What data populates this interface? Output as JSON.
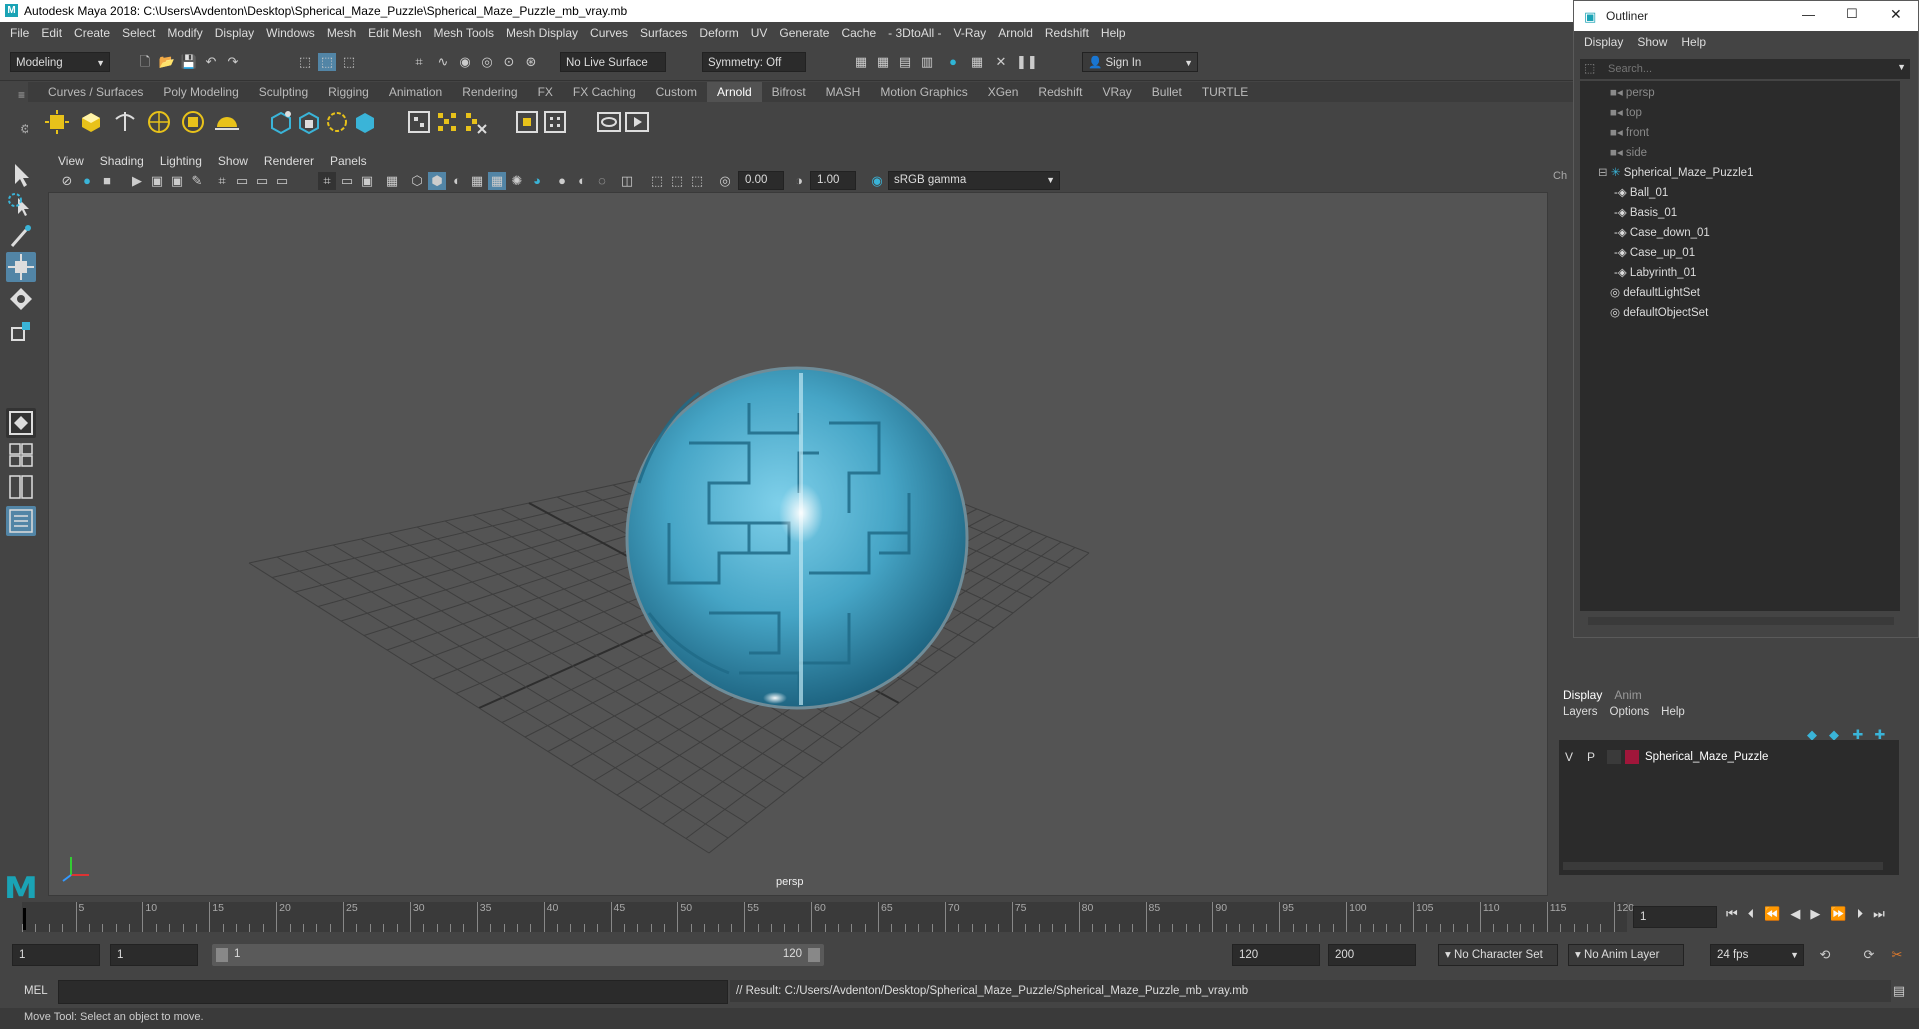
{
  "window": {
    "title": "Autodesk Maya 2018: C:\\Users\\Avdenton\\Desktop\\Spherical_Maze_Puzzle\\Spherical_Maze_Puzzle_mb_vray.mb",
    "logo_letter": "M"
  },
  "menubar": [
    "File",
    "Edit",
    "Create",
    "Select",
    "Modify",
    "Display",
    "Windows",
    "Mesh",
    "Edit Mesh",
    "Mesh Tools",
    "Mesh Display",
    "Curves",
    "Surfaces",
    "Deform",
    "UV",
    "Generate",
    "Cache",
    "- 3DtoAll -",
    "V-Ray",
    "Arnold",
    "Redshift",
    "Help"
  ],
  "statusline": {
    "mode": "Modeling",
    "live_surface": "No Live Surface",
    "symmetry": "Symmetry: Off",
    "sign_in": "Sign In"
  },
  "shelf": {
    "tabs": [
      "Curves / Surfaces",
      "Poly Modeling",
      "Sculpting",
      "Rigging",
      "Animation",
      "Rendering",
      "FX",
      "FX Caching",
      "Custom",
      "Arnold",
      "Bifrost",
      "MASH",
      "Motion Graphics",
      "XGen",
      "Redshift",
      "VRay",
      "Bullet",
      "TURTLE"
    ],
    "active_tab": "Arnold"
  },
  "viewport": {
    "menu": [
      "View",
      "Shading",
      "Lighting",
      "Show",
      "Renderer",
      "Panels"
    ],
    "exposure": "0.00",
    "gamma": "1.00",
    "color_space": "sRGB gamma",
    "camera_label": "persp"
  },
  "outliner": {
    "title": "Outliner",
    "menu": [
      "Display",
      "Show",
      "Help"
    ],
    "search_placeholder": "Search...",
    "cameras": [
      "persp",
      "top",
      "front",
      "side"
    ],
    "group": "Spherical_Maze_Puzzle1",
    "children": [
      "Ball_01",
      "Basis_01",
      "Case_down_01",
      "Case_up_01",
      "Labyrinth_01"
    ],
    "sets": [
      "defaultLightSet",
      "defaultObjectSet"
    ],
    "channel_tab_cut": "Ch"
  },
  "layers": {
    "tabs": [
      "Display",
      "Anim"
    ],
    "active_tab": "Display",
    "menu": [
      "Layers",
      "Options",
      "Help"
    ],
    "rows": [
      {
        "v": "V",
        "p": "P",
        "name": "Spherical_Maze_Puzzle",
        "color": "#a0163a"
      }
    ]
  },
  "timeline": {
    "ticks": [
      "5",
      "10",
      "15",
      "20",
      "25",
      "30",
      "35",
      "40",
      "45",
      "50",
      "55",
      "60",
      "65",
      "70",
      "75",
      "80",
      "85",
      "90",
      "95",
      "100",
      "105",
      "110",
      "115",
      "120"
    ],
    "current_frame": "1"
  },
  "range": {
    "start": "1",
    "start2": "1",
    "slider_start": "1",
    "slider_end": "120",
    "end": "120",
    "end2": "200",
    "character_set": "No Character Set",
    "anim_layer": "No Anim Layer",
    "fps": "24 fps"
  },
  "command": {
    "lang": "MEL",
    "result": "// Result: C:/Users/Avdenton/Desktop/Spherical_Maze_Puzzle/Spherical_Maze_Puzzle_mb_vray.mb"
  },
  "help_line": "Move Tool: Select an object to move.",
  "colors": {
    "accent": "#5285a6",
    "sphere": "#4aa8c8",
    "layer_swatch": "#a0163a"
  }
}
